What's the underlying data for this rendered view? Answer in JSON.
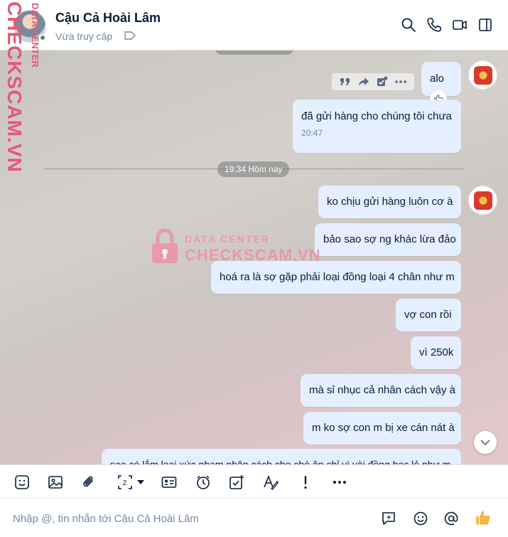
{
  "header": {
    "contact_name": "Cậu Cả Hoài Lâm",
    "status": "Vừa truy cập",
    "icons": [
      "search-icon",
      "phone-icon",
      "video-call-icon",
      "sidebar-toggle-icon",
      "tag-icon"
    ]
  },
  "watermark": {
    "side_text": "CHECKSCAM.VN",
    "side_small": "DATA CENTER",
    "center_top": "DATA CENTER",
    "center_main": "CHECKSCAM.VN"
  },
  "chat": {
    "divider_label": "19:34 Hôm nay",
    "messages_group_1": [
      {
        "text": "alo"
      },
      {
        "text": "đã gửi hàng cho chúng tôi chưa",
        "time": "20:47"
      }
    ],
    "messages_group_2": [
      {
        "text": "ko chịu gửi hàng luôn cơ à"
      },
      {
        "text": "bảo sao sợ ng khác lừa đảo"
      },
      {
        "text": "hoá ra là sợ gặp phải loại đồng loại 4 chân như m"
      },
      {
        "text": "vợ con rồi"
      },
      {
        "text": "vì 250k"
      },
      {
        "text": "mà sỉ nhục cả nhân cách vậy à"
      },
      {
        "text": "m ko sợ con m bị xe cán nát à"
      },
      {
        "text": "sao có lắm loại xức phạm nhân cách cho chó ăn chỉ vì vài đồng bạc lẻ như m"
      }
    ],
    "hover_actions": [
      "quote-icon",
      "forward-icon",
      "select-icon",
      "more-icon"
    ]
  },
  "toolbar": {
    "icons": [
      "sticker-icon",
      "image-icon",
      "attachment-icon",
      "screenshot-icon",
      "contact-card-icon",
      "reminder-icon",
      "task-icon",
      "text-format-icon",
      "urgent-icon",
      "more-icon"
    ]
  },
  "composer": {
    "placeholder": "Nhập @, tin nhắn tới Cậu Cả Hoài Lâm"
  },
  "colors": {
    "bubble": "#e5efff",
    "accent": "#0068ff",
    "watermark": "#e8577a"
  }
}
